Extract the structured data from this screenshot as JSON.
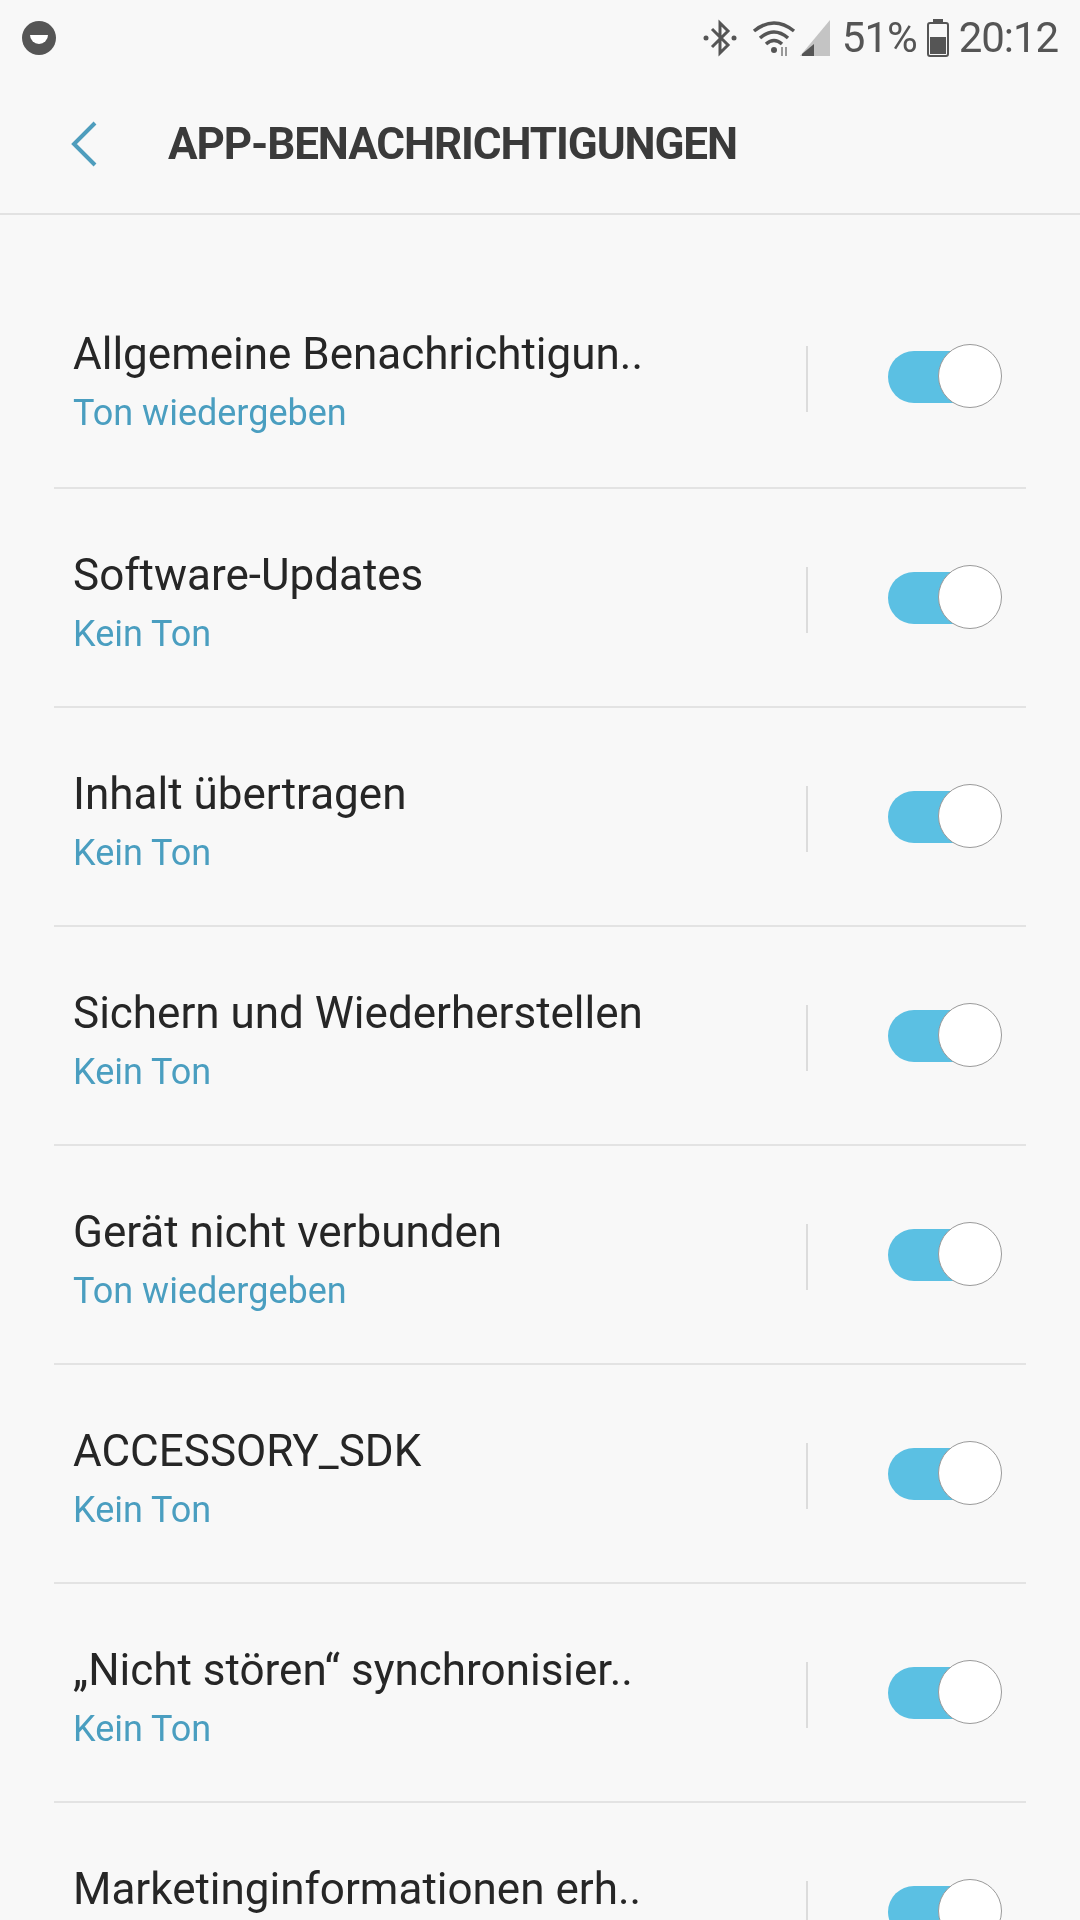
{
  "status_bar": {
    "battery": "51%",
    "time": "20:12"
  },
  "header": {
    "title": "APP-BENACHRICHTIGUNGEN"
  },
  "categories": [
    {
      "title": "Allgemeine Benachrichtigun..",
      "sound": "Ton wiedergeben",
      "on": true
    },
    {
      "title": "Software-Updates",
      "sound": "Kein Ton",
      "on": true
    },
    {
      "title": "Inhalt übertragen",
      "sound": "Kein Ton",
      "on": true
    },
    {
      "title": "Sichern und Wiederherstellen",
      "sound": "Kein Ton",
      "on": true
    },
    {
      "title": "Gerät nicht verbunden",
      "sound": "Ton wiedergeben",
      "on": true
    },
    {
      "title": "ACCESSORY_SDK",
      "sound": "Kein Ton",
      "on": true
    },
    {
      "title": "„Nicht stören“ synchronisier..",
      "sound": "Kein Ton",
      "on": true
    },
    {
      "title": "Marketinginformationen erh..",
      "on": true
    }
  ]
}
